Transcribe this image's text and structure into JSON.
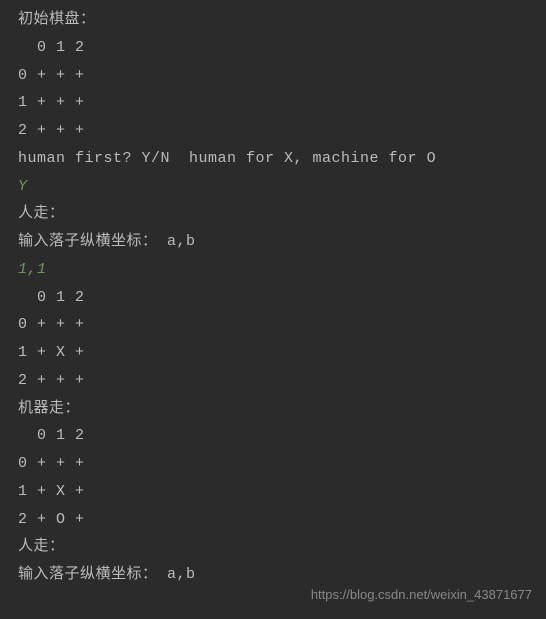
{
  "terminal": {
    "lines": [
      {
        "text": "初始棋盘：",
        "type": "output"
      },
      {
        "text": "  0 1 2",
        "type": "output"
      },
      {
        "text": "0 + + +",
        "type": "output"
      },
      {
        "text": "1 + + +",
        "type": "output"
      },
      {
        "text": "2 + + +",
        "type": "output"
      },
      {
        "text": "human first? Y/N  human for X, machine for O",
        "type": "output"
      },
      {
        "text": "Y",
        "type": "input"
      },
      {
        "text": "人走：",
        "type": "output"
      },
      {
        "text": "输入落子纵横坐标： a,b",
        "type": "output"
      },
      {
        "text": "1,1",
        "type": "input"
      },
      {
        "text": "  0 1 2",
        "type": "output"
      },
      {
        "text": "0 + + +",
        "type": "output"
      },
      {
        "text": "1 + X +",
        "type": "output"
      },
      {
        "text": "2 + + +",
        "type": "output"
      },
      {
        "text": "机器走：",
        "type": "output"
      },
      {
        "text": "  0 1 2",
        "type": "output"
      },
      {
        "text": "0 + + +",
        "type": "output"
      },
      {
        "text": "1 + X +",
        "type": "output"
      },
      {
        "text": "2 + O +",
        "type": "output"
      },
      {
        "text": "人走：",
        "type": "output"
      },
      {
        "text": "输入落子纵横坐标： a,b",
        "type": "output"
      }
    ]
  },
  "watermark": "https://blog.csdn.net/weixin_43871677"
}
